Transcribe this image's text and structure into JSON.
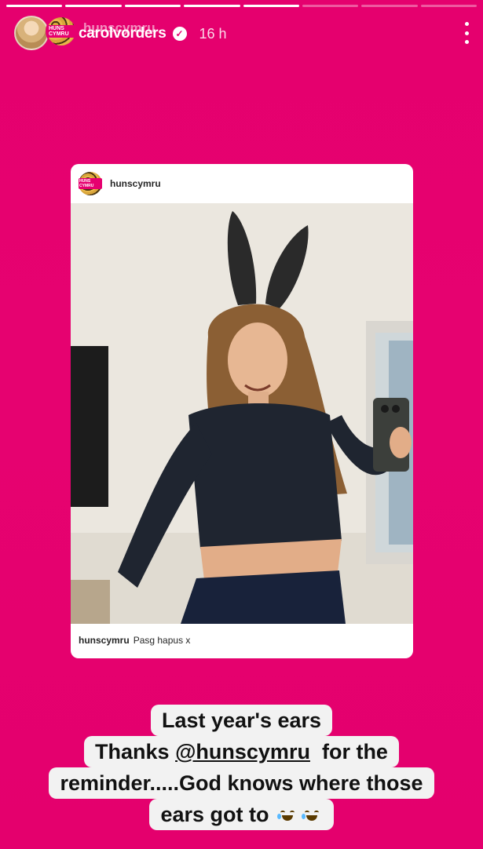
{
  "story": {
    "progress_count": 8,
    "progress_done": 5,
    "header": {
      "username": "carolvorders",
      "overlapping_username": "hunscymru",
      "time": "16 h",
      "verified_icon": "verified-check-icon",
      "avatar_badge": "HUNS CYMRU"
    },
    "shared_post": {
      "username": "hunscymru",
      "avatar_badge": "HUNS CYMRU",
      "caption_user": "hunscymru",
      "caption_text": "Pasg hapus x"
    },
    "text_lines": {
      "line1": "Last year's ears",
      "line2_before": "Thanks ",
      "line2_mention": "@hunscymru",
      "line2_after": "  for the",
      "line3": "reminder.....God knows where those",
      "line4": "ears got to"
    },
    "emoji": "face-with-tears-of-joy",
    "colors": {
      "background": "#e6006f",
      "sticker_bg": "#f2f2f2"
    }
  }
}
